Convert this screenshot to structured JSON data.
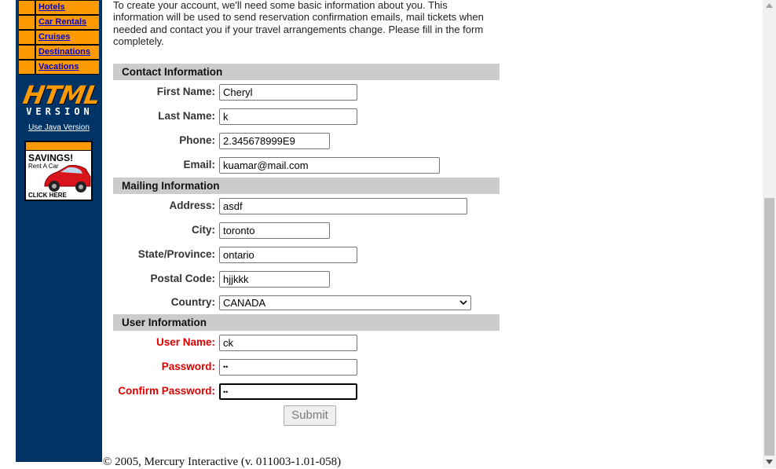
{
  "nav": {
    "items": [
      {
        "label": "Hotels"
      },
      {
        "label": "Car Rentals"
      },
      {
        "label": "Cruises"
      },
      {
        "label": "Destinations"
      },
      {
        "label": "Vacations"
      }
    ],
    "logo_html": "HTML",
    "logo_version": "VERSION",
    "java_link": "Use Java Version",
    "ad": {
      "savings": "SAVINGS!",
      "rent": "Rent A Car",
      "click": "CLICK HERE"
    }
  },
  "intro_text": "To create your account, we'll need some basic information about you. This information will be used to send reservation confirmation emails, mail tickets when needed and contact you if your travel arrangements change. Please fill in the form completely.",
  "sections": {
    "contact": "Contact Information",
    "mailing": "Mailing Information",
    "user": "User Information"
  },
  "fields": {
    "first_name": {
      "label": "First Name:",
      "value": "Cheryl"
    },
    "last_name": {
      "label": "Last Name:",
      "value": "k"
    },
    "phone": {
      "label": "Phone:",
      "value": "2.345678999E9"
    },
    "email": {
      "label": "Email:",
      "value": "kuamar@mail.com"
    },
    "address": {
      "label": "Address:",
      "value": "asdf"
    },
    "city": {
      "label": "City:",
      "value": "toronto"
    },
    "state": {
      "label": "State/Province:",
      "value": "ontario"
    },
    "postal": {
      "label": "Postal Code:",
      "value": "hjjkkk"
    },
    "country": {
      "label": "Country:",
      "value": "CANADA"
    },
    "username": {
      "label": "User Name:",
      "value": "ck"
    },
    "password": {
      "label": "Password:",
      "value": "••"
    },
    "confirm_password": {
      "label": "Confirm Password:",
      "value": "••"
    }
  },
  "submit_label": "Submit",
  "footer": "© 2005, Mercury Interactive (v. 011003-1.01-058)",
  "colors": {
    "sidebar": "#003366",
    "nav_orange": "#ff9900",
    "required_label": "#e00000",
    "section_bar": "#cccccc"
  }
}
